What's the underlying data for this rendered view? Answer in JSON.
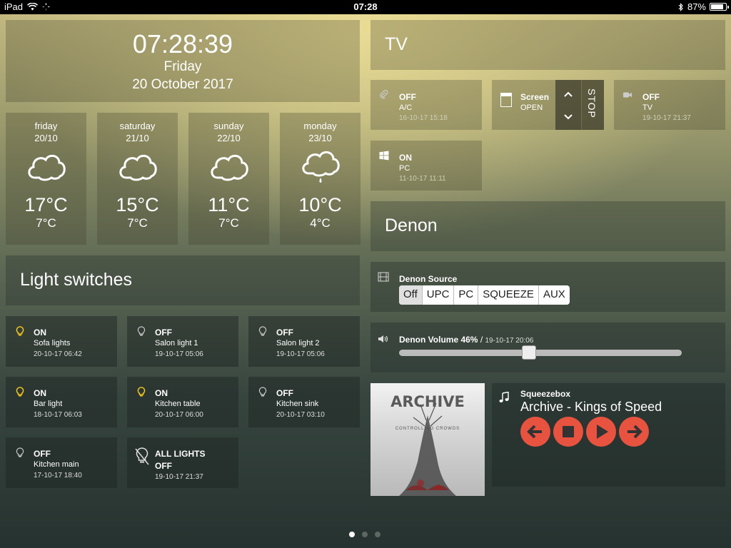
{
  "status_bar": {
    "device": "iPad",
    "time": "07:28",
    "battery": "87%",
    "battery_level": 0.87
  },
  "clock": {
    "time": "07:28:39",
    "day": "Friday",
    "date": "20 October 2017"
  },
  "weather": [
    {
      "day": "friday",
      "date": "20/10",
      "high": "17°C",
      "low": "7°C",
      "icon": "cloud-icon"
    },
    {
      "day": "saturday",
      "date": "21/10",
      "high": "15°C",
      "low": "7°C",
      "icon": "cloud-icon"
    },
    {
      "day": "sunday",
      "date": "22/10",
      "high": "11°C",
      "low": "7°C",
      "icon": "cloud-icon"
    },
    {
      "day": "monday",
      "date": "23/10",
      "high": "10°C",
      "low": "4°C",
      "icon": "cloud-rain-icon"
    }
  ],
  "lights": {
    "title": "Light switches",
    "switches": [
      {
        "state": "ON",
        "name": "Sofa lights",
        "timestamp": "20-10-17 06:42",
        "on": true
      },
      {
        "state": "OFF",
        "name": "Salon light 1",
        "timestamp": "19-10-17 05:06",
        "on": false
      },
      {
        "state": "OFF",
        "name": "Salon light 2",
        "timestamp": "19-10-17 05:06",
        "on": false
      },
      {
        "state": "ON",
        "name": "Bar light",
        "timestamp": "18-10-17 06:03",
        "on": true
      },
      {
        "state": "ON",
        "name": "Kitchen table",
        "timestamp": "20-10-17 06:00",
        "on": true
      },
      {
        "state": "OFF",
        "name": "Kitchen sink",
        "timestamp": "20-10-17 03:10",
        "on": false
      },
      {
        "state": "OFF",
        "name": "Kitchen main",
        "timestamp": "17-10-17 18:40",
        "on": false
      }
    ],
    "all_lights": {
      "label": "ALL LIGHTS",
      "state": "OFF",
      "timestamp": "19-10-17 21:37"
    }
  },
  "tv": {
    "title": "TV",
    "ac": {
      "state": "OFF",
      "name": "A/C",
      "timestamp": "16-10-17 15:18"
    },
    "screen": {
      "name": "Screen",
      "state": "OPEN",
      "stop_label": "STOP"
    },
    "tv": {
      "state": "OFF",
      "name": "TV",
      "timestamp": "19-10-17 21:37"
    },
    "pc": {
      "state": "ON",
      "name": "PC",
      "timestamp": "11-10-17 11:11"
    }
  },
  "denon": {
    "title": "Denon",
    "source_label": "Denon Source",
    "sources": [
      "Off",
      "UPC",
      "PC",
      "SQUEEZE",
      "AUX"
    ],
    "selected_source": "Off",
    "volume_label": "Denon Volume 46%",
    "volume_sep": "/",
    "volume_timestamp": "19-10-17 20:06",
    "volume_level": 0.46
  },
  "squeezebox": {
    "label": "Squeezebox",
    "track": "Archive - Kings of Speed",
    "album_title": "ARCHIVE",
    "album_subtitle": "CONTROLLING          CROWDS"
  },
  "pages": {
    "count": 3,
    "current": 0
  },
  "colors": {
    "accent": "#e8533f",
    "bulb_on": "#f0c419"
  }
}
